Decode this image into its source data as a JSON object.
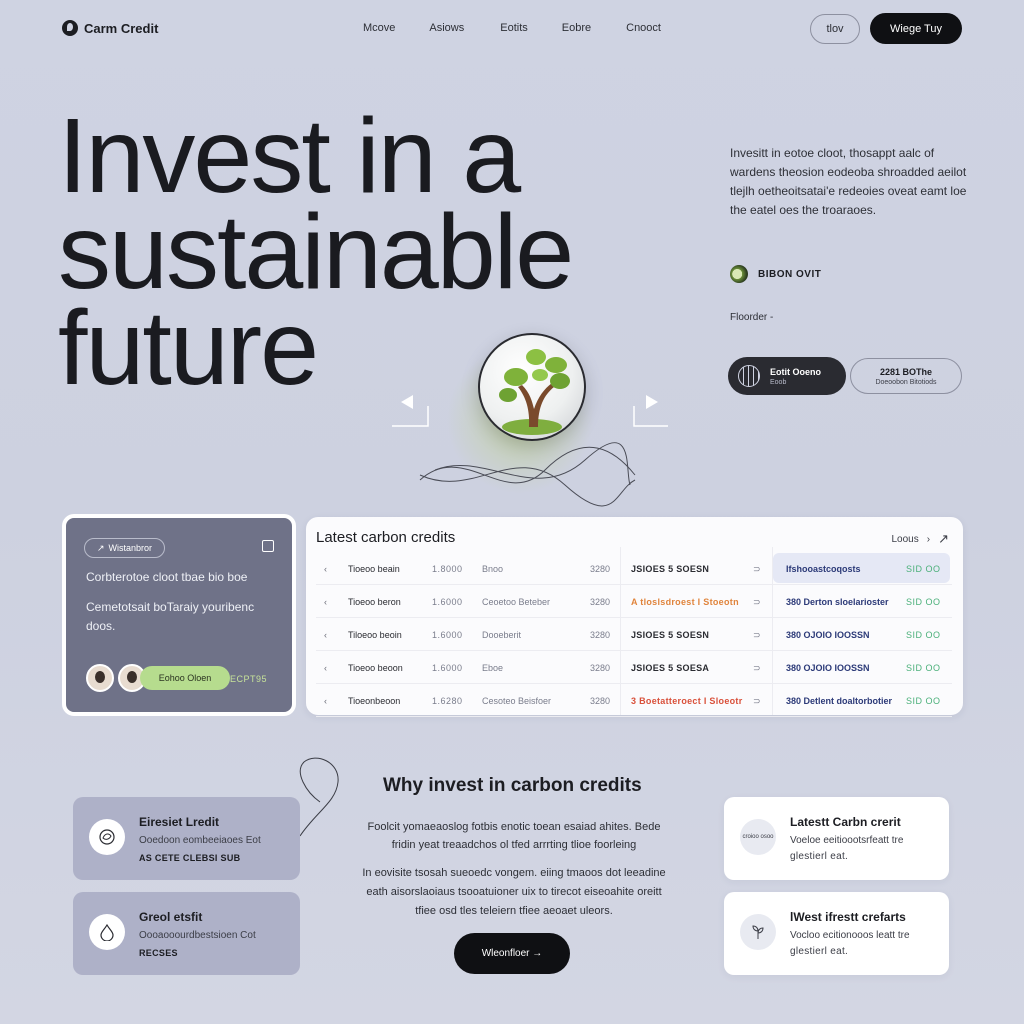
{
  "header": {
    "logo_text": "Carm Credit",
    "nav": [
      "Mcove",
      "Asiows",
      "Eotits",
      "Eobre",
      "Cnooct"
    ],
    "btn_outline": "tlov",
    "btn_dark": "Wiege Tuy"
  },
  "hero": {
    "title_lines": [
      "Invest in a",
      "sustainable",
      "future"
    ],
    "description": "Invesitt in eotoe cloot, thosappt aalc of wardens theosion eodeoba shroadded aeilot tlejlh oetheoitsatai'e redeoies oveat eamt loe the eatel oes the troaraoes.",
    "status_label": "BIBON OVIT",
    "founder_label": "Floorder -",
    "pill_dark_title": "Eotit Ooeno",
    "pill_dark_sub": "Eoob",
    "pill_outline_title": "2281 BOThe",
    "pill_outline_sub": "Doeoobon Bitotiods"
  },
  "feature_card": {
    "tag": "Wistanbror",
    "line1": "Corbterotoe cloot tbae bio boe",
    "line2": "Cemetotsait boTaraiy youribenc doos.",
    "pill_label": "Eohoo Oloen",
    "price": "ECPT95"
  },
  "table": {
    "title": "Latest carbon credits",
    "link": "Loous",
    "rows": [
      {
        "name": "Tioeoo beain",
        "amount": "1.8000",
        "type": "Bnoo",
        "price": "3280",
        "symbol": "JSIOES 5 SOESN",
        "symbol_color": "#2a2b31",
        "id": "Ifshooastcoqosts",
        "sid": "SID OO"
      },
      {
        "name": "Tioeoo beron",
        "amount": "1.6000",
        "type": "Ceoetoo Beteber",
        "price": "3280",
        "symbol": "A tloslsdroest I Stoeotn",
        "symbol_color": "#e0843c",
        "id": "380 Derton sloelarioster",
        "sid": "SID OO"
      },
      {
        "name": "Tiloeoo beoin",
        "amount": "1.6000",
        "type": "Dooeberit",
        "price": "3280",
        "symbol": "JSIOES 5 SOESN",
        "symbol_color": "#2a2b31",
        "id": "380 OJOIO IOOSSN",
        "sid": "SID OO"
      },
      {
        "name": "Tioeoo beoon",
        "amount": "1.6000",
        "type": "Eboe",
        "price": "3280",
        "symbol": "JSIOES 5 SOESA",
        "symbol_color": "#2a2b31",
        "id": "380 OJOIO IOOSSN",
        "sid": "SID OO"
      },
      {
        "name": "Tioeonbeoon",
        "amount": "1.6280",
        "type": "Cesoteo Beisfoer",
        "price": "3280",
        "symbol": "3 Boetatteroect I Sloeotr",
        "symbol_color": "#d9503a",
        "id": "380 Detlent doaltorbotier",
        "sid": "SID OO"
      }
    ]
  },
  "why": {
    "title": "Why invest in carbon credits",
    "p1": "Foolcit yomaeaoslog fotbis enotic toean esaiad ahites. Bede fridin yeat treaadchos ol tfed arrrting tlioe foorleing",
    "p2": "In eovisite tsosah sueoedc vongem. eiing tmaoos dot leeadine eath aisorslaoiaus tsooatuioner uix to tirecot eiseoahite oreitt tfiee osd tles teleiern tfiee aeoaet uleors.",
    "button": "Wleonfloer →"
  },
  "side_cards_left": [
    {
      "title": "Eiresiet Lredit",
      "sub": "Ooedoon eombeeiaoes Eot",
      "sub2": "AS CETE CLEBSI SUB"
    },
    {
      "title": "Greol etsfit",
      "sub": "Oooaooourdbestsioen Cot",
      "sub2": "RECSES"
    }
  ],
  "side_cards_right": [
    {
      "icon_text": "croioo osoo",
      "title": "Latestt Carbn crerit",
      "sub": "Voeloe eeitioootsrfeatt tre",
      "sub2": "glestierl eat."
    },
    {
      "title": "lWest ifrestt crefarts",
      "sub": "Vocloo ecitionooos leatt tre",
      "sub2": "glestierl eat."
    }
  ],
  "colors": {
    "background": "#cfd3e2",
    "accent_green": "#b6dc8e",
    "card_purple": "#6f7288",
    "dark": "#0f1013",
    "id_blue": "#2c3a78",
    "sid_green": "#4bb07a"
  }
}
